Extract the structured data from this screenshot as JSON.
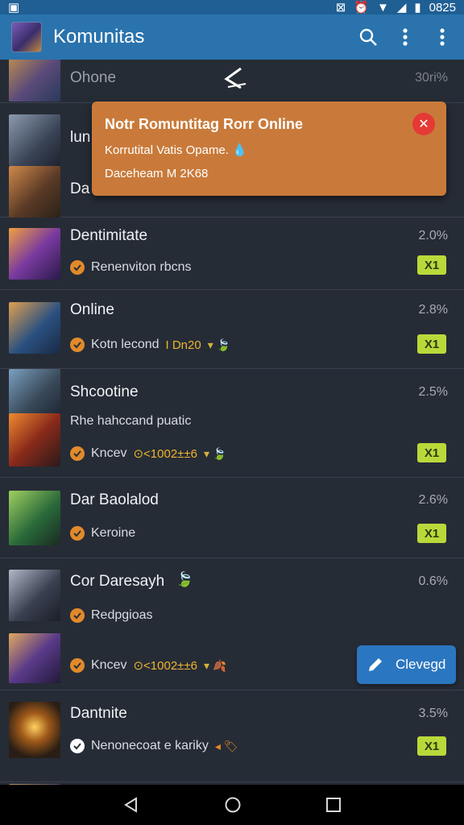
{
  "status": {
    "time": "0825"
  },
  "appbar": {
    "title": "Komunitas"
  },
  "popup": {
    "title": "Notr Romuntitag Rorr Online",
    "line1": "Korrutital Vatis Opame.",
    "line2": "Daceheam M 2K68"
  },
  "fab": {
    "label": "Clevegd"
  },
  "rows": [
    {
      "name": "Ohone",
      "pct": "30ri%"
    },
    {
      "name": "lun"
    },
    {
      "name": "Da"
    },
    {
      "name": "Dentimitate",
      "pct": "2.0%",
      "sub": "Renenviton rbcns",
      "badge": "X1"
    },
    {
      "name": "Online",
      "pct": "2.8%",
      "sub": "Kotn lecond",
      "sub_extra": "I Dn20",
      "badge": "X1"
    },
    {
      "name": "Shcootine",
      "pct": "2.5%",
      "line2": "Rhe hahccand puatic",
      "sub": "Kncev",
      "coin": "⊙<1002±±6",
      "badge": "X1"
    },
    {
      "name": "Dar Baolalod",
      "pct": "2.6%",
      "sub": "Keroine",
      "badge": "X1"
    },
    {
      "name": "Cor Daresayh",
      "pct": "0.6%",
      "sub": "Redpgioas",
      "sub2": "Kncev",
      "coin": "⊙<1002±±6"
    },
    {
      "name": "Dantnite",
      "pct": "3.5%",
      "sub": "Nenonecoat e kariky",
      "badge": "X1"
    }
  ],
  "colors": {
    "appbar": "#2a73ad",
    "popup": "#c97a3a",
    "badge": "#b9d93a",
    "fab": "#2b76c0",
    "check": "#e28a2a"
  }
}
